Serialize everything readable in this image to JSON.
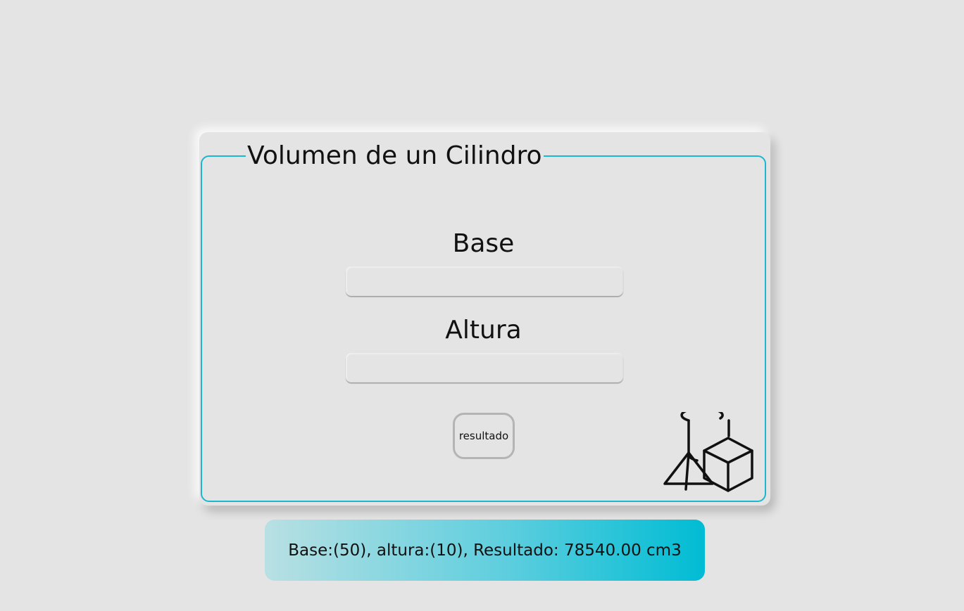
{
  "form": {
    "title": "Volumen de un Cilindro",
    "base_label": "Base",
    "base_value": "",
    "altura_label": "Altura",
    "altura_value": "",
    "submit_label": "resultado"
  },
  "illustration": {
    "icon": "geometric-shapes-icon"
  },
  "result": {
    "text": "Base:(50), altura:(10), Resultado: 78540.00 cm3"
  },
  "colors": {
    "background": "#e4e4e4",
    "accent": "#1ab7cf",
    "result_gradient_start": "#b8e0e3",
    "result_gradient_end": "#00bcd4"
  }
}
